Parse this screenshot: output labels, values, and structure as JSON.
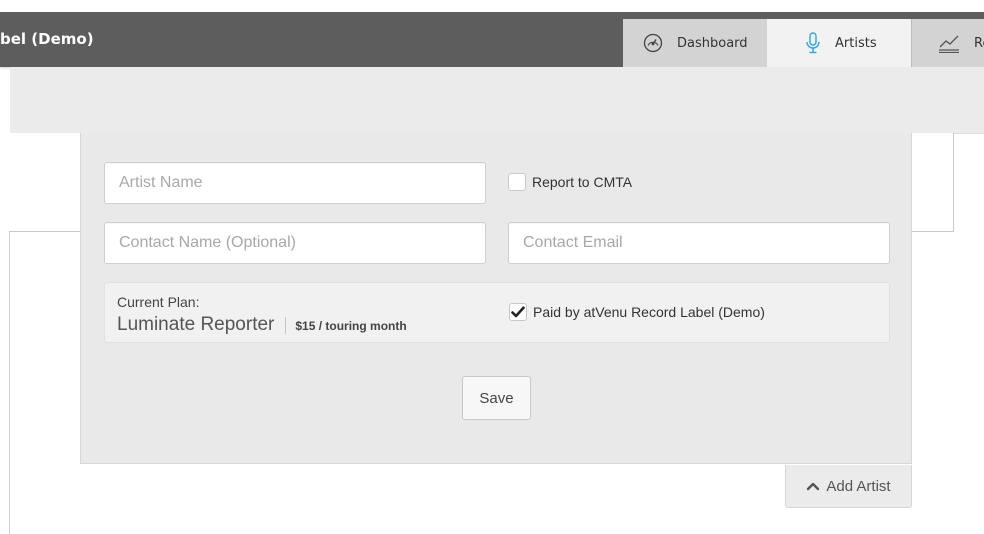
{
  "header": {
    "app_title": "bel (Demo)",
    "tabs": [
      {
        "label": "Dashboard",
        "icon": "gauge-icon"
      },
      {
        "label": "Artists",
        "icon": "microphone-icon",
        "active": true
      },
      {
        "label": "Re",
        "icon": "line-chart-icon"
      }
    ]
  },
  "form": {
    "artist_name_placeholder": "Artist Name",
    "report_cmta_label": "Report to CMTA",
    "report_cmta_checked": false,
    "contact_name_placeholder": "Contact Name (Optional)",
    "contact_email_placeholder": "Contact Email",
    "plan": {
      "label": "Current Plan:",
      "name": "Luminate Reporter",
      "price": "$15 / touring month"
    },
    "paid_by_label": "Paid by atVenu Record Label (Demo)",
    "paid_by_checked": true,
    "save_label": "Save"
  },
  "add_artist_label": "Add Artist",
  "colors": {
    "topbar": "#5d5d5d",
    "accent_blue": "#2aa8e0"
  }
}
